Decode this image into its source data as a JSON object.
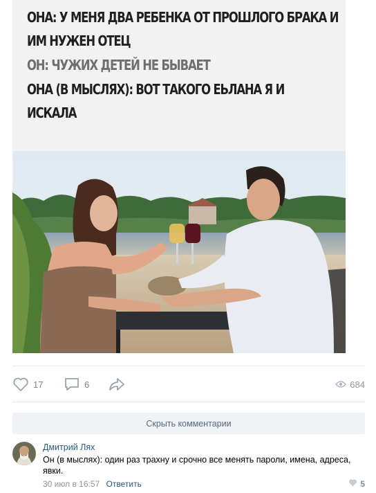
{
  "post": {
    "caption_lines": [
      "ОНА: У МЕНЯ ДВА РЕБЕНКА ОТ ПРОШЛОГО БРАКА И",
      "ИМ НУЖЕН ОТЕЦ",
      "ОН: ЧУЖИХ ДЕТЕЙ НЕ БЫВАЕТ",
      "ОНА (В МЫСЛЯХ): ВОТ ТАКОГО ЕЬЛАНА Я И",
      "ИСКАЛА"
    ],
    "likes": "17",
    "comments": "6",
    "views": "684"
  },
  "hide_comments_label": "Скрыть комментарии",
  "comment": {
    "author": "Дмитрий Лях",
    "text": "Он (в мыслях): один раз трахну и срочно все менять пароли, имена, адреса, явки.",
    "date": "30 июл в 16:57",
    "reply_label": "Ответить",
    "likes": "5"
  },
  "colors": {
    "link": "#2a5885",
    "muted": "#828282",
    "button_bg": "#f0f2f5"
  },
  "icons": [
    "heart-icon",
    "comment-icon",
    "share-icon",
    "eye-icon",
    "small-heart-icon"
  ]
}
